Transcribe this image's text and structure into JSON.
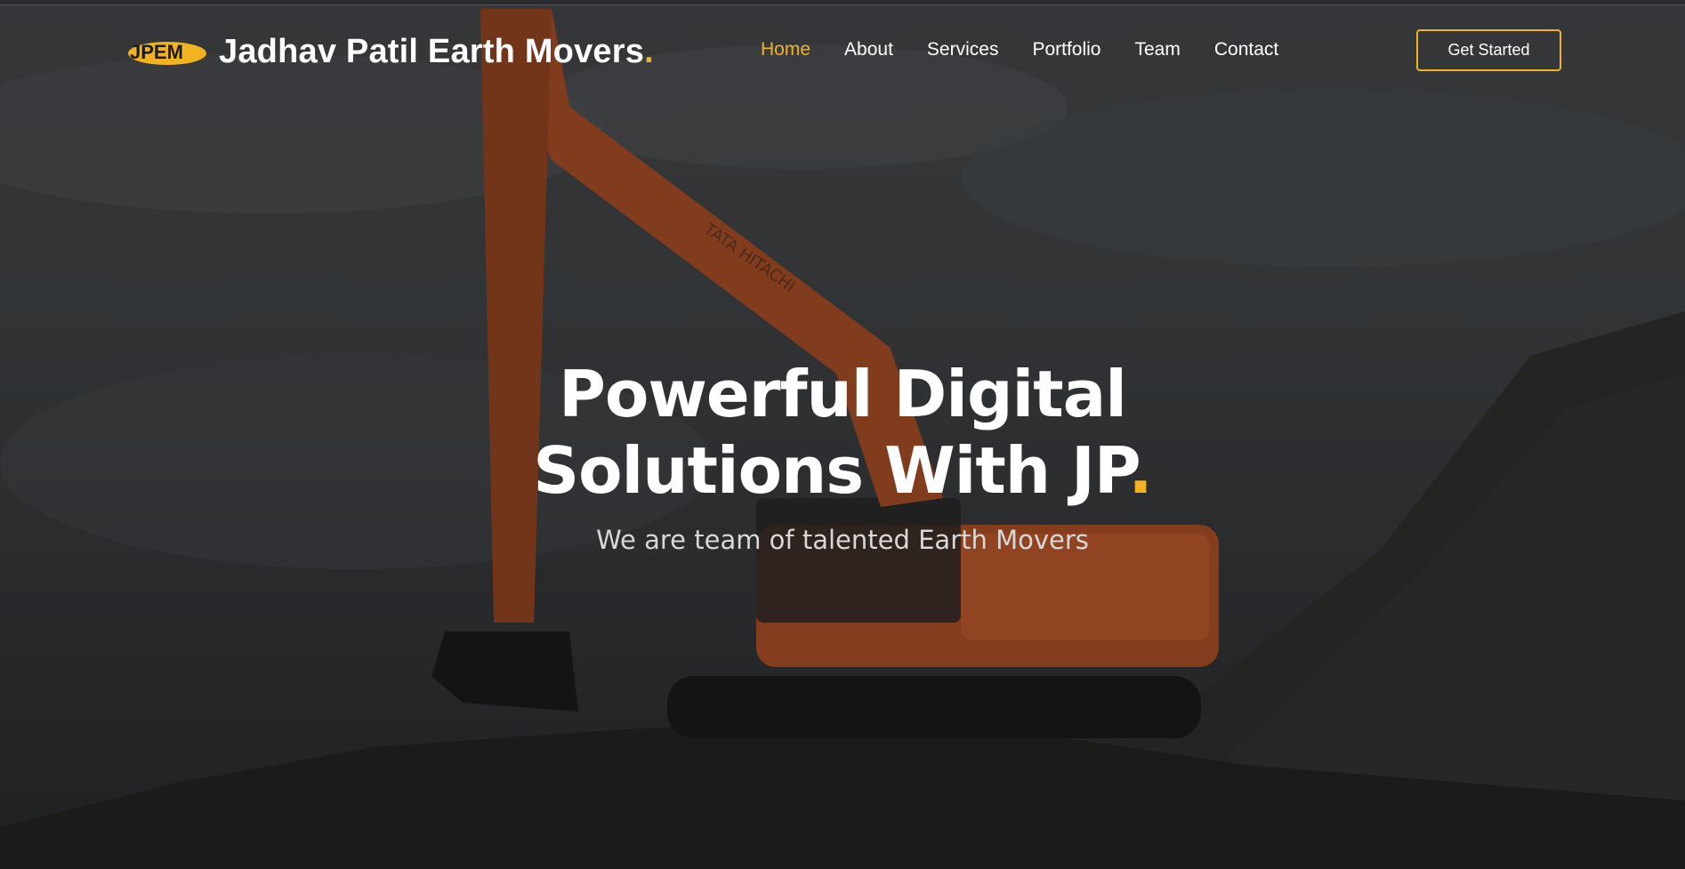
{
  "colors": {
    "accent": "#f2b322",
    "text": "#ffffff",
    "subtext": "#d8d8d8"
  },
  "header": {
    "logo_text": "JPEM",
    "brand_name": "Jadhav Patil Earth Movers",
    "brand_dot": ".",
    "nav": [
      {
        "label": "Home",
        "active": true
      },
      {
        "label": "About",
        "active": false
      },
      {
        "label": "Services",
        "active": false
      },
      {
        "label": "Portfolio",
        "active": false
      },
      {
        "label": "Team",
        "active": false
      },
      {
        "label": "Contact",
        "active": false
      }
    ],
    "cta_label": "Get Started"
  },
  "hero": {
    "title_line1": "Powerful Digital",
    "title_line2": "Solutions With JP",
    "title_dot": ".",
    "subtitle": "We are team of talented Earth Movers",
    "background_image": "excavator-on-soil-pile",
    "machine_brand_text": "TATA HITACHI"
  }
}
